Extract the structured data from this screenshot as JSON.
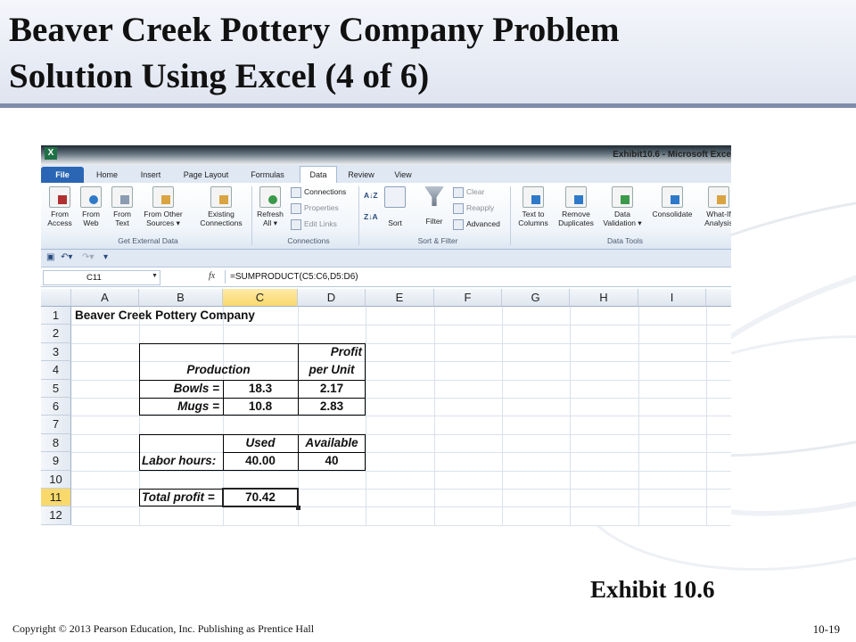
{
  "slide": {
    "title_line1": "Beaver Creek Pottery Company Problem",
    "title_line2": "Solution Using Excel (4 of  6)",
    "exhibit": "Exhibit 10.6",
    "copyright": "Copyright © 2013 Pearson Education, Inc. Publishing as Prentice Hall",
    "page_number": "10-19"
  },
  "excel": {
    "app_icon": "X",
    "window_title": "Exhibit10.6  -  Microsoft Exce",
    "tabs": [
      "File",
      "Home",
      "Insert",
      "Page Layout",
      "Formulas",
      "Data",
      "Review",
      "View"
    ],
    "active_tab": "Data",
    "ribbon": {
      "get_external_data": {
        "label": "Get External Data",
        "from_access": [
          "From",
          "Access"
        ],
        "from_web": [
          "From",
          "Web"
        ],
        "from_text": [
          "From",
          "Text"
        ],
        "from_other": [
          "From Other",
          "Sources ▾"
        ],
        "existing": [
          "Existing",
          "Connections"
        ]
      },
      "connections": {
        "label": "Connections",
        "refresh": [
          "Refresh",
          "All ▾"
        ],
        "connections": "Connections",
        "properties": "Properties",
        "edit_links": "Edit Links"
      },
      "sort_filter": {
        "label": "Sort & Filter",
        "sort": "Sort",
        "filter": "Filter",
        "clear": "Clear",
        "reapply": "Reapply",
        "advanced": "Advanced"
      },
      "data_tools": {
        "label": "Data Tools",
        "text_to_columns": [
          "Text to",
          "Columns"
        ],
        "remove_duplicates": [
          "Remove",
          "Duplicates"
        ],
        "data_validation": [
          "Data",
          "Validation ▾"
        ],
        "consolidate": "Consolidate",
        "what_if": [
          "What-If",
          "Analysis"
        ]
      }
    },
    "qat_icons": [
      "save-icon",
      "undo-icon",
      "redo-icon",
      "customize-icon"
    ],
    "name_box": "C11",
    "fx_label": "fx",
    "formula": "=SUMPRODUCT(C5:C6,D5:D6)",
    "columns": [
      "A",
      "B",
      "C",
      "D",
      "E",
      "F",
      "G",
      "H",
      "I"
    ],
    "selected_column": "C",
    "rows": [
      "1",
      "2",
      "3",
      "4",
      "5",
      "6",
      "7",
      "8",
      "9",
      "10",
      "11",
      "12"
    ],
    "selected_row": "11",
    "cells": {
      "a1": "Beaver Creek Pottery Company",
      "d3": "Profit",
      "b4": "Production",
      "d4": "per Unit",
      "b5": "Bowls =",
      "c5": "18.3",
      "d5": "2.17",
      "b6": "Mugs =",
      "c6": "10.8",
      "d6": "2.83",
      "c8": "Used",
      "d8": "Available",
      "b9": "Labor hours:",
      "c9": "40.00",
      "d9": "40",
      "b11": "Total profit =",
      "c11": "70.42"
    }
  }
}
